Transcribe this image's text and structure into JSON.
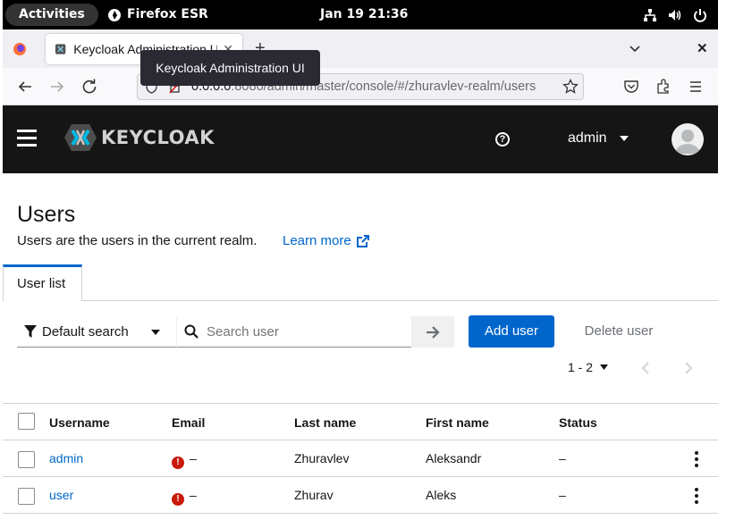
{
  "topbar": {
    "activities": "Activities",
    "app_name": "Firefox ESR",
    "clock": "Jan 19  21:36"
  },
  "browser": {
    "tab_title": "Keycloak Administration UI",
    "tooltip": "Keycloak Administration UI",
    "url_host": "0.0.0.0",
    "url_rest": ":8080/admin/master/console/#/zhuravlev-realm/users"
  },
  "header": {
    "logo_text": "KEYCLOAK",
    "username": "admin"
  },
  "page": {
    "title": "Users",
    "description": "Users are the users in the current realm.",
    "learn_more": "Learn more"
  },
  "tabs": [
    {
      "label": "User list",
      "active": true
    }
  ],
  "toolbar": {
    "search_type": "Default search",
    "search_placeholder": "Search user",
    "add_user": "Add user",
    "delete_user": "Delete user",
    "pagination": "1 - 2"
  },
  "table": {
    "headers": [
      "Username",
      "Email",
      "Last name",
      "First name",
      "Status"
    ],
    "rows": [
      {
        "username": "admin",
        "email": "–",
        "last_name": "Zhuravlev",
        "first_name": "Aleksandr",
        "status": "–"
      },
      {
        "username": "user",
        "email": "–",
        "last_name": "Zhurav",
        "first_name": "Aleks",
        "status": "–"
      }
    ]
  },
  "colors": {
    "accent": "#0066cc",
    "header_bg": "#151515",
    "warning": "#c9190b"
  }
}
